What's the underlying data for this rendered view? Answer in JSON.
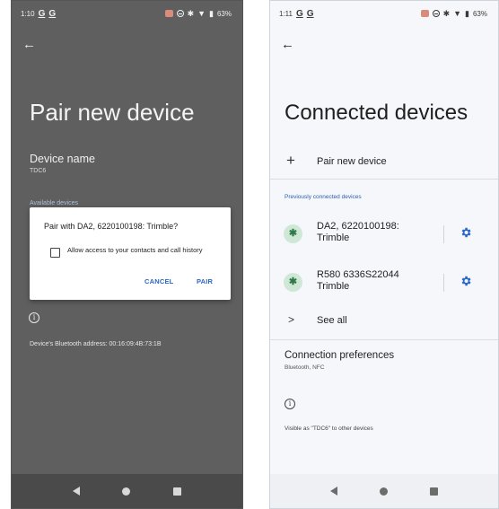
{
  "left_screen": {
    "status": {
      "time": "1:10",
      "app_icons": [
        "G",
        "G"
      ],
      "battery": "63%"
    },
    "title": "Pair new device",
    "device_name_label": "Device name",
    "device_name_value": "TDC6",
    "available_devices_label": "Available devices",
    "dialog": {
      "title": "Pair with DA2, 6220100198: Trimble?",
      "checkbox_label": "Allow access to your contacts and call history",
      "checkbox_checked": false,
      "cancel_label": "CANCEL",
      "pair_label": "PAIR"
    },
    "info_icon": "i",
    "bt_address": "Device's Bluetooth address: 00:16:09:4B:73:1B"
  },
  "right_screen": {
    "status": {
      "time": "1:11",
      "app_icons": [
        "G",
        "G"
      ],
      "battery": "63%"
    },
    "title": "Connected devices",
    "pair_new_device_label": "Pair new device",
    "previously_connected_label": "Previously connected devices",
    "devices": [
      {
        "name_line1": "DA2, 6220100198:",
        "name_line2": "Trimble",
        "icon": "bluetooth-icon"
      },
      {
        "name_line1": "R580 6336S22044",
        "name_line2": "Trimble",
        "icon": "bluetooth-icon"
      }
    ],
    "see_all_label": "See all",
    "connection_preferences_label": "Connection preferences",
    "connection_preferences_sub": "Bluetooth, NFC",
    "info_icon": "i",
    "visible_as": "Visible as \"TDC6\" to other devices"
  },
  "colors": {
    "accent_blue": "#2a67c7",
    "bluetooth_green": "#2f7a4a",
    "bluetooth_bg": "#cfe8d6"
  }
}
